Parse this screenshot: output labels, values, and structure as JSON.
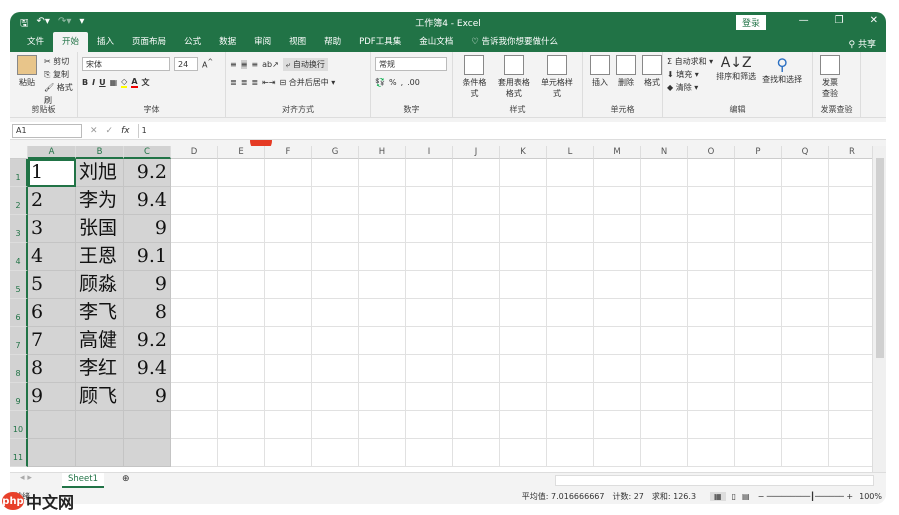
{
  "title": {
    "doc": "工作簿4 - Excel",
    "login": "登录"
  },
  "tabs": [
    "文件",
    "开始",
    "插入",
    "页面布局",
    "公式",
    "数据",
    "审阅",
    "视图",
    "帮助",
    "PDF工具集",
    "金山文档"
  ],
  "tellme": "告诉我你想要做什么",
  "share": "共享",
  "ribbon": {
    "clipboard": {
      "paste": "粘贴",
      "cut": "剪切",
      "copy": "复制",
      "painter": "格式刷",
      "label": "剪贴板"
    },
    "font": {
      "name": "宋体",
      "size": "24",
      "label": "字体"
    },
    "align": {
      "wrap": "自动换行",
      "merge": "合并后居中",
      "label": "对齐方式"
    },
    "number": {
      "format": "常规",
      "label": "数字"
    },
    "styles": {
      "cond": "条件格式",
      "table": "套用表格格式",
      "cell": "单元格样式",
      "label": "样式"
    },
    "cells": {
      "insert": "插入",
      "delete": "删除",
      "format": "格式",
      "label": "单元格"
    },
    "edit": {
      "autosum": "自动求和",
      "fill": "填充",
      "clear": "清除",
      "sort": "排序和筛选",
      "find": "查找和选择",
      "label": "编辑"
    },
    "invoice": {
      "check": "发票查验",
      "label": "发票查验"
    }
  },
  "formula": {
    "namebox": "A1",
    "fx": "fx",
    "value": "1"
  },
  "columns": [
    "A",
    "B",
    "C",
    "D",
    "E",
    "F",
    "G",
    "H",
    "I",
    "J",
    "K",
    "L",
    "M",
    "N",
    "O",
    "P",
    "Q",
    "R"
  ],
  "rows": [
    [
      "1",
      "刘旭",
      "9.2"
    ],
    [
      "2",
      "李为",
      "9.4"
    ],
    [
      "3",
      "张国",
      "9"
    ],
    [
      "4",
      "王恩",
      "9.1"
    ],
    [
      "5",
      "顾淼",
      "9"
    ],
    [
      "6",
      "李飞",
      "8"
    ],
    [
      "7",
      "高健",
      "9.2"
    ],
    [
      "8",
      "李红",
      "9.4"
    ],
    [
      "9",
      "顾飞",
      "9"
    ],
    [
      "",
      "",
      " "
    ],
    [
      "",
      "",
      ""
    ]
  ],
  "sheet": "Sheet1",
  "status": {
    "mode": "就绪",
    "avg": "平均值: 7.016666667",
    "count": "计数: 27",
    "sum": "求和: 126.3",
    "zoom": "100%"
  },
  "watermark": "中文网"
}
